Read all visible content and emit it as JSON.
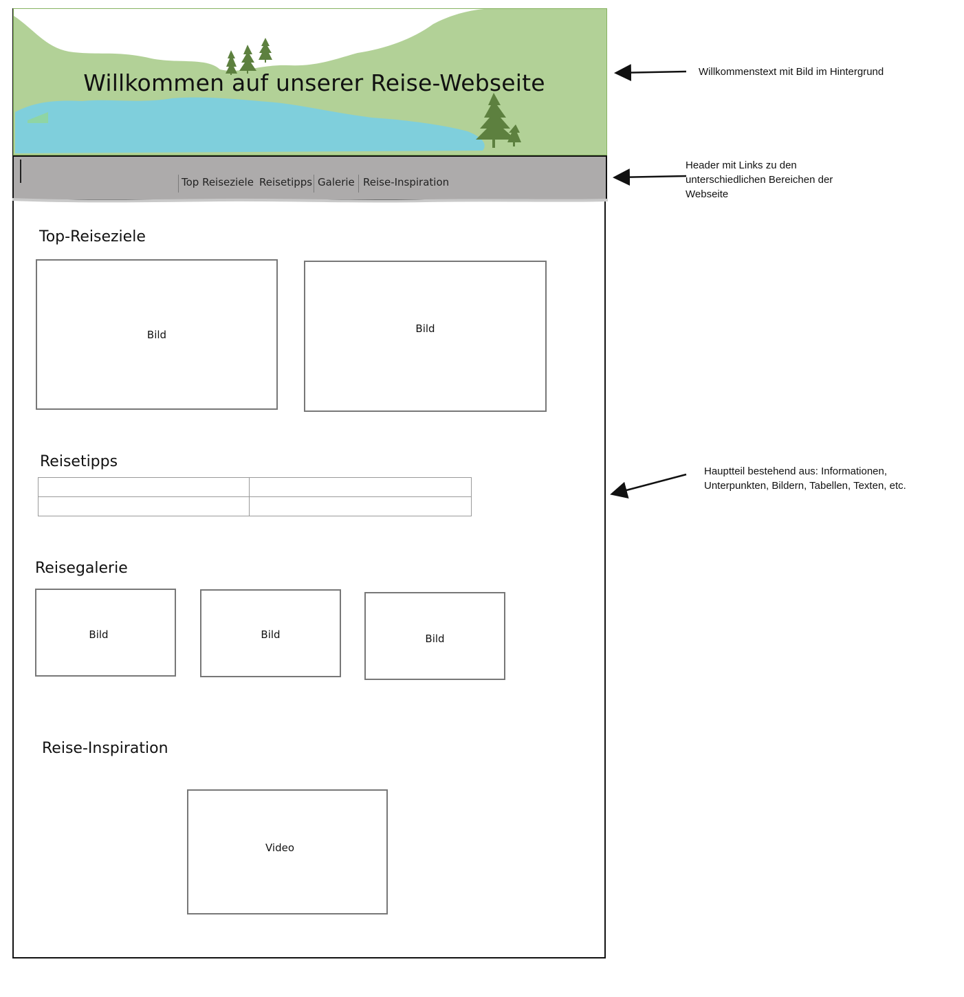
{
  "hero": {
    "title": "Willkommen auf unserer Reise-Webseite"
  },
  "nav": {
    "links": [
      "Top Reiseziele",
      "Reisetipps",
      "Galerie",
      "Reise-Inspiration"
    ]
  },
  "sections": {
    "top": {
      "title": "Top-Reiseziele",
      "images": [
        "Bild",
        "Bild"
      ]
    },
    "tips": {
      "title": "Reisetipps",
      "table": {
        "rows": 2,
        "cols": 2
      }
    },
    "gallery": {
      "title": "Reisegalerie",
      "images": [
        "Bild",
        "Bild",
        "Bild"
      ]
    },
    "inspiration": {
      "title": "Reise-Inspiration",
      "video": "Video"
    }
  },
  "annotations": {
    "hero_note": "Willkommenstext mit Bild im Hintergrund",
    "nav_note": [
      "Header mit Links zu den",
      "unterschiedlichen Bereichen der",
      "Webseite"
    ],
    "main_note": [
      "Hauptteil bestehend aus: Informationen,",
      "Unterpunkten, Bildern, Tabellen, Texten, etc."
    ]
  },
  "colors": {
    "hill": "#b2d197",
    "water": "#7fcfdc",
    "tree": "#5d803f",
    "nav": "#adabab"
  }
}
